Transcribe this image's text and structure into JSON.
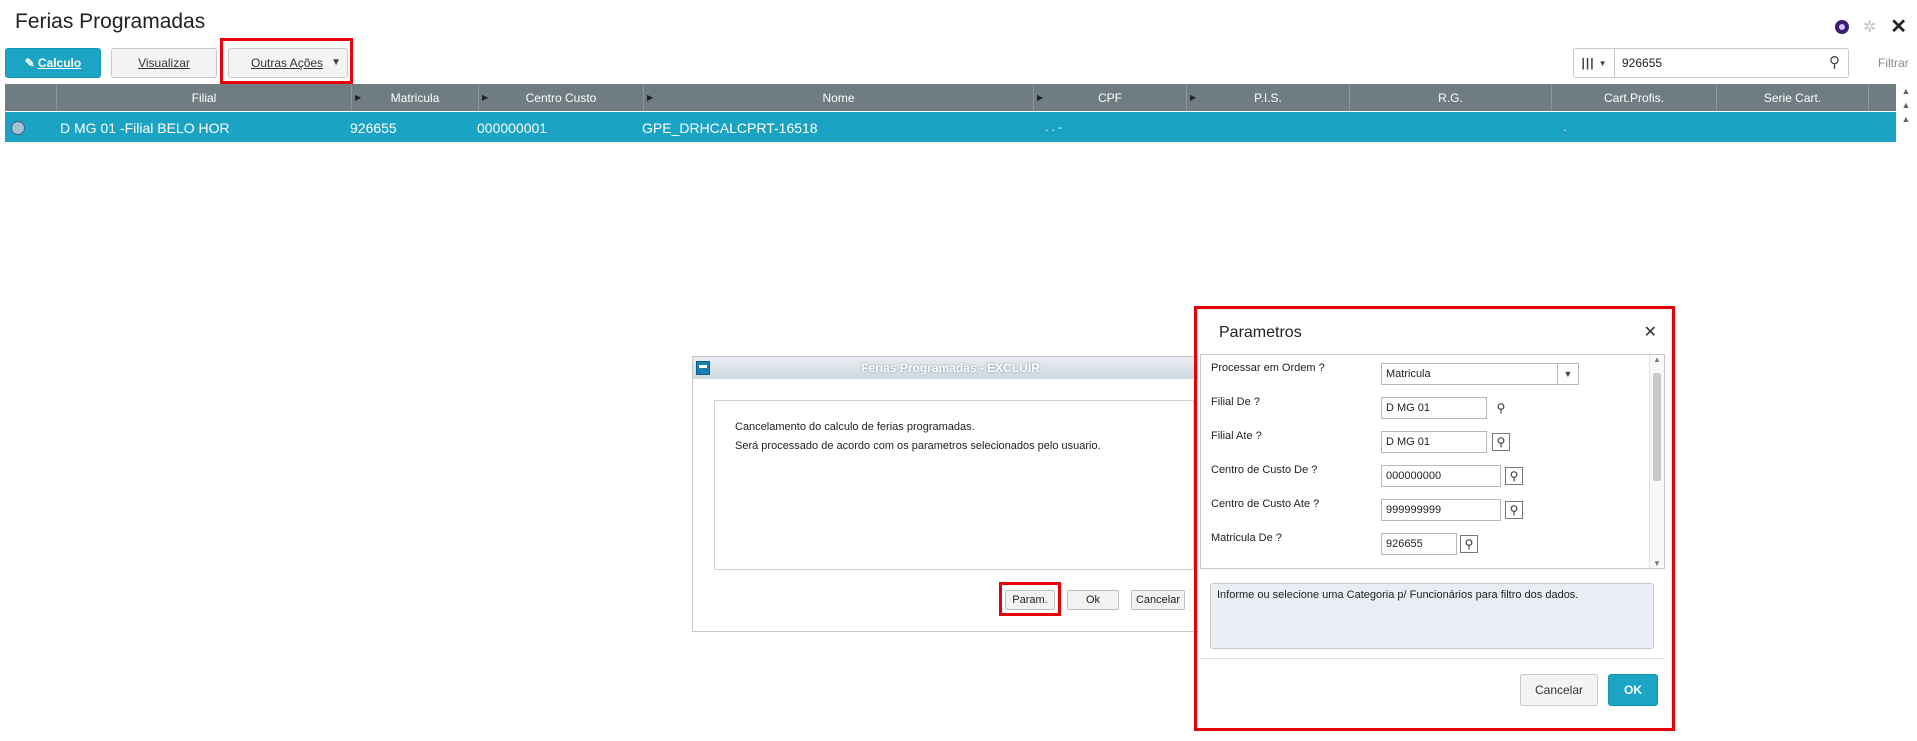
{
  "header": {
    "title": "Ferias Programadas",
    "icons": [
      "user-avatar-icon",
      "gear-icon",
      "close-icon"
    ]
  },
  "toolbar": {
    "calculo_label": "Calculo",
    "visualizar_label": "Visualizar",
    "outras_acoes_label": "Outras Ações",
    "search_value": "926655",
    "filter_label": "Filtrar"
  },
  "grid": {
    "columns": [
      "Filial",
      "Matricula",
      "Centro Custo",
      "Nome",
      "CPF",
      "P.I.S.",
      "R.G.",
      "Cart.Profis.",
      "Serie Cart."
    ],
    "rows": [
      {
        "filial": "D MG 01 -Filial BELO HOR",
        "matricula": "926655",
        "centro_custo": "000000001",
        "nome": "GPE_DRHCALCPRT-16518",
        "cpf": ".  .  -",
        "cart_profis": "."
      }
    ]
  },
  "legacy_dialog": {
    "title": "Ferias Programadas - EXCLUIR",
    "line1": "Cancelamento do calculo de ferias programadas.",
    "line2": "Será processado de acordo com os parametros selecionados pelo usuario.",
    "param_label": "Param.",
    "ok_label": "Ok",
    "cancel_label": "Cancelar"
  },
  "params_dialog": {
    "title": "Parametros",
    "fields": [
      {
        "label": "Processar em Ordem ?",
        "value": "Matricula"
      },
      {
        "label": "Filial De ?",
        "value": "D MG 01"
      },
      {
        "label": "Filial Ate ?",
        "value": "D MG 01"
      },
      {
        "label": "Centro de Custo De ?",
        "value": "000000000"
      },
      {
        "label": "Centro de Custo Ate ?",
        "value": "999999999"
      },
      {
        "label": "Matricula De ?",
        "value": "926655"
      }
    ],
    "hint": "Informe ou selecione uma Categoria p/ Funcionários para filtro dos dados.",
    "cancel_label": "Cancelar",
    "ok_label": "OK"
  },
  "colors": {
    "primary": "#1ca4c4",
    "header_bg": "#6f7d83",
    "selected_row": "#1ba3c4",
    "highlight": "#e8000b"
  }
}
